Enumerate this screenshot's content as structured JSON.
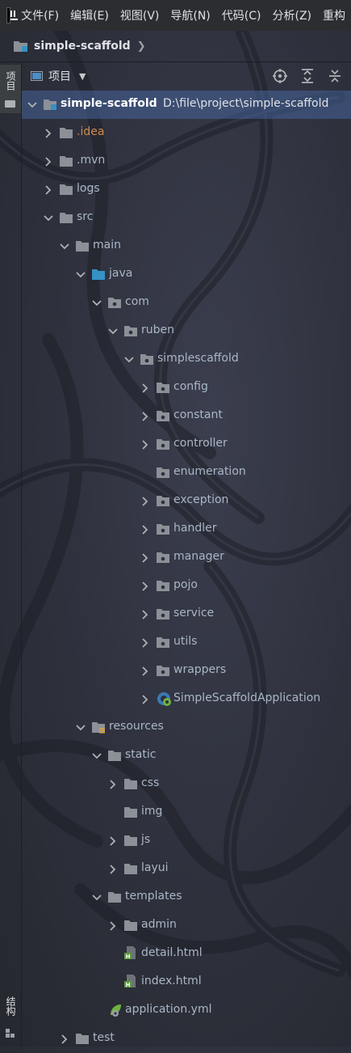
{
  "menu": {
    "items": [
      "文件(F)",
      "编辑(E)",
      "视图(V)",
      "导航(N)",
      "代码(C)",
      "分析(Z)",
      "重构"
    ]
  },
  "navbar": {
    "title": "simple-scaffold"
  },
  "toolwindows": {
    "project_label": "项目",
    "structure_label": "结构"
  },
  "panel": {
    "title": "项目",
    "actions": [
      "locate-icon",
      "expand-all-icon",
      "collapse-all-icon"
    ]
  },
  "tree": [
    {
      "label": "simple-scaffold",
      "path": "D:\\file\\project\\simple-scaffold",
      "depth": 0,
      "expanded": true,
      "icon": "module-folder-icon",
      "selected": true
    },
    {
      "label": ".idea",
      "depth": 1,
      "expanded": false,
      "icon": "folder-icon",
      "style": "excluded"
    },
    {
      "label": ".mvn",
      "depth": 1,
      "expanded": false,
      "icon": "folder-icon"
    },
    {
      "label": "logs",
      "depth": 1,
      "expanded": false,
      "icon": "folder-icon"
    },
    {
      "label": "src",
      "depth": 1,
      "expanded": true,
      "icon": "folder-icon"
    },
    {
      "label": "main",
      "depth": 2,
      "expanded": true,
      "icon": "folder-icon"
    },
    {
      "label": "java",
      "depth": 3,
      "expanded": true,
      "icon": "source-folder-icon"
    },
    {
      "label": "com",
      "depth": 4,
      "expanded": true,
      "icon": "package-icon"
    },
    {
      "label": "ruben",
      "depth": 5,
      "expanded": true,
      "icon": "package-icon"
    },
    {
      "label": "simplescaffold",
      "depth": 6,
      "expanded": true,
      "icon": "package-icon"
    },
    {
      "label": "config",
      "depth": 7,
      "expanded": false,
      "icon": "package-icon"
    },
    {
      "label": "constant",
      "depth": 7,
      "expanded": false,
      "icon": "package-icon"
    },
    {
      "label": "controller",
      "depth": 7,
      "expanded": false,
      "icon": "package-icon"
    },
    {
      "label": "enumeration",
      "depth": 7,
      "icon": "package-icon"
    },
    {
      "label": "exception",
      "depth": 7,
      "expanded": false,
      "icon": "package-icon"
    },
    {
      "label": "handler",
      "depth": 7,
      "expanded": false,
      "icon": "package-icon"
    },
    {
      "label": "manager",
      "depth": 7,
      "expanded": false,
      "icon": "package-icon"
    },
    {
      "label": "pojo",
      "depth": 7,
      "expanded": false,
      "icon": "package-icon"
    },
    {
      "label": "service",
      "depth": 7,
      "expanded": false,
      "icon": "package-icon"
    },
    {
      "label": "utils",
      "depth": 7,
      "expanded": false,
      "icon": "package-icon"
    },
    {
      "label": "wrappers",
      "depth": 7,
      "expanded": false,
      "icon": "package-icon"
    },
    {
      "label": "SimpleScaffoldApplication",
      "depth": 7,
      "expanded": false,
      "icon": "spring-boot-class-icon"
    },
    {
      "label": "resources",
      "depth": 3,
      "expanded": true,
      "icon": "resources-folder-icon"
    },
    {
      "label": "static",
      "depth": 4,
      "expanded": true,
      "icon": "folder-icon"
    },
    {
      "label": "css",
      "depth": 5,
      "expanded": false,
      "icon": "folder-icon"
    },
    {
      "label": "img",
      "depth": 5,
      "icon": "folder-icon"
    },
    {
      "label": "js",
      "depth": 5,
      "expanded": false,
      "icon": "folder-icon"
    },
    {
      "label": "layui",
      "depth": 5,
      "expanded": false,
      "icon": "folder-icon"
    },
    {
      "label": "templates",
      "depth": 4,
      "expanded": true,
      "icon": "folder-icon"
    },
    {
      "label": "admin",
      "depth": 5,
      "expanded": false,
      "icon": "folder-icon"
    },
    {
      "label": "detail.html",
      "depth": 5,
      "icon": "html-file-icon"
    },
    {
      "label": "index.html",
      "depth": 5,
      "icon": "html-file-icon"
    },
    {
      "label": "application.yml",
      "depth": 4,
      "icon": "spring-yaml-icon"
    },
    {
      "label": "test",
      "depth": 2,
      "expanded": false,
      "icon": "folder-icon"
    }
  ],
  "colors": {
    "folder": "#8c9097",
    "source_folder": "#3592c4",
    "html_badge": "#5a9b3d",
    "spring": "#6db33f",
    "selection": "#3f5a8a",
    "excluded_text": "#d08a4a"
  }
}
